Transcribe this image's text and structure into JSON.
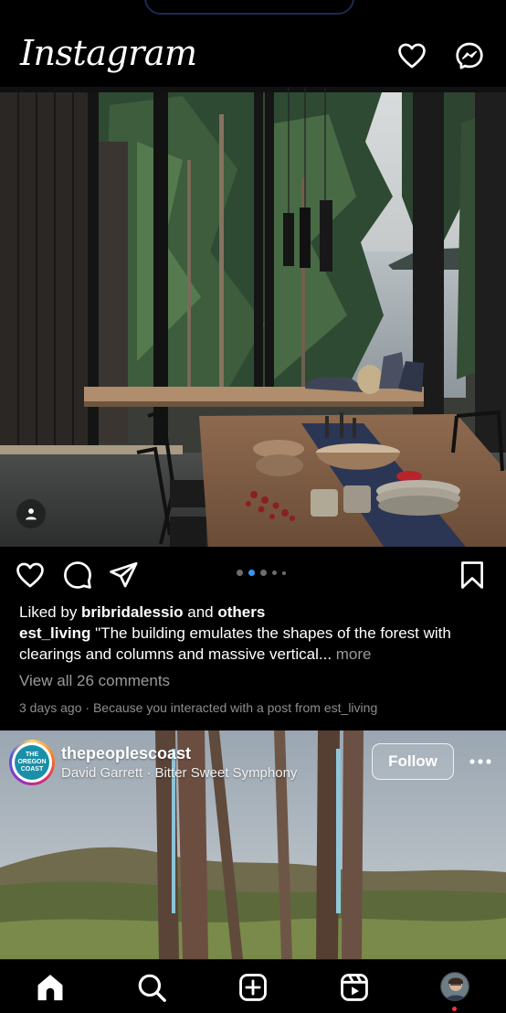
{
  "header": {
    "logo": "Instagram",
    "icons": [
      "heart-icon",
      "messenger-icon"
    ]
  },
  "post1": {
    "carousel": {
      "count": 5,
      "active_index": 1
    },
    "liked_by_prefix": "Liked by ",
    "liked_by_user": "bribridalessio",
    "liked_by_and": " and ",
    "liked_by_others": "others",
    "caption_user": "est_living",
    "caption_text": " \"The building emulates the shapes of the forest with clearings and columns and massive vertical...",
    "more_label": " more",
    "view_comments": "View all 26 comments",
    "timestamp": "3 days ago",
    "separator": " · ",
    "reason": "Because you interacted with a post from est_living"
  },
  "post2": {
    "username": "thepeoplescoast",
    "audio": "David Garrett · Bitter Sweet Symphony",
    "follow_label": "Follow",
    "avatar_text": "THE OREGON COAST"
  },
  "tabbar": {
    "items": [
      "home-icon",
      "search-icon",
      "create-icon",
      "reels-icon",
      "profile-avatar"
    ]
  },
  "colors": {
    "background": "#000000",
    "accent": "#3797f0",
    "muted": "#8e8e8e",
    "notification": "#ff3040"
  }
}
